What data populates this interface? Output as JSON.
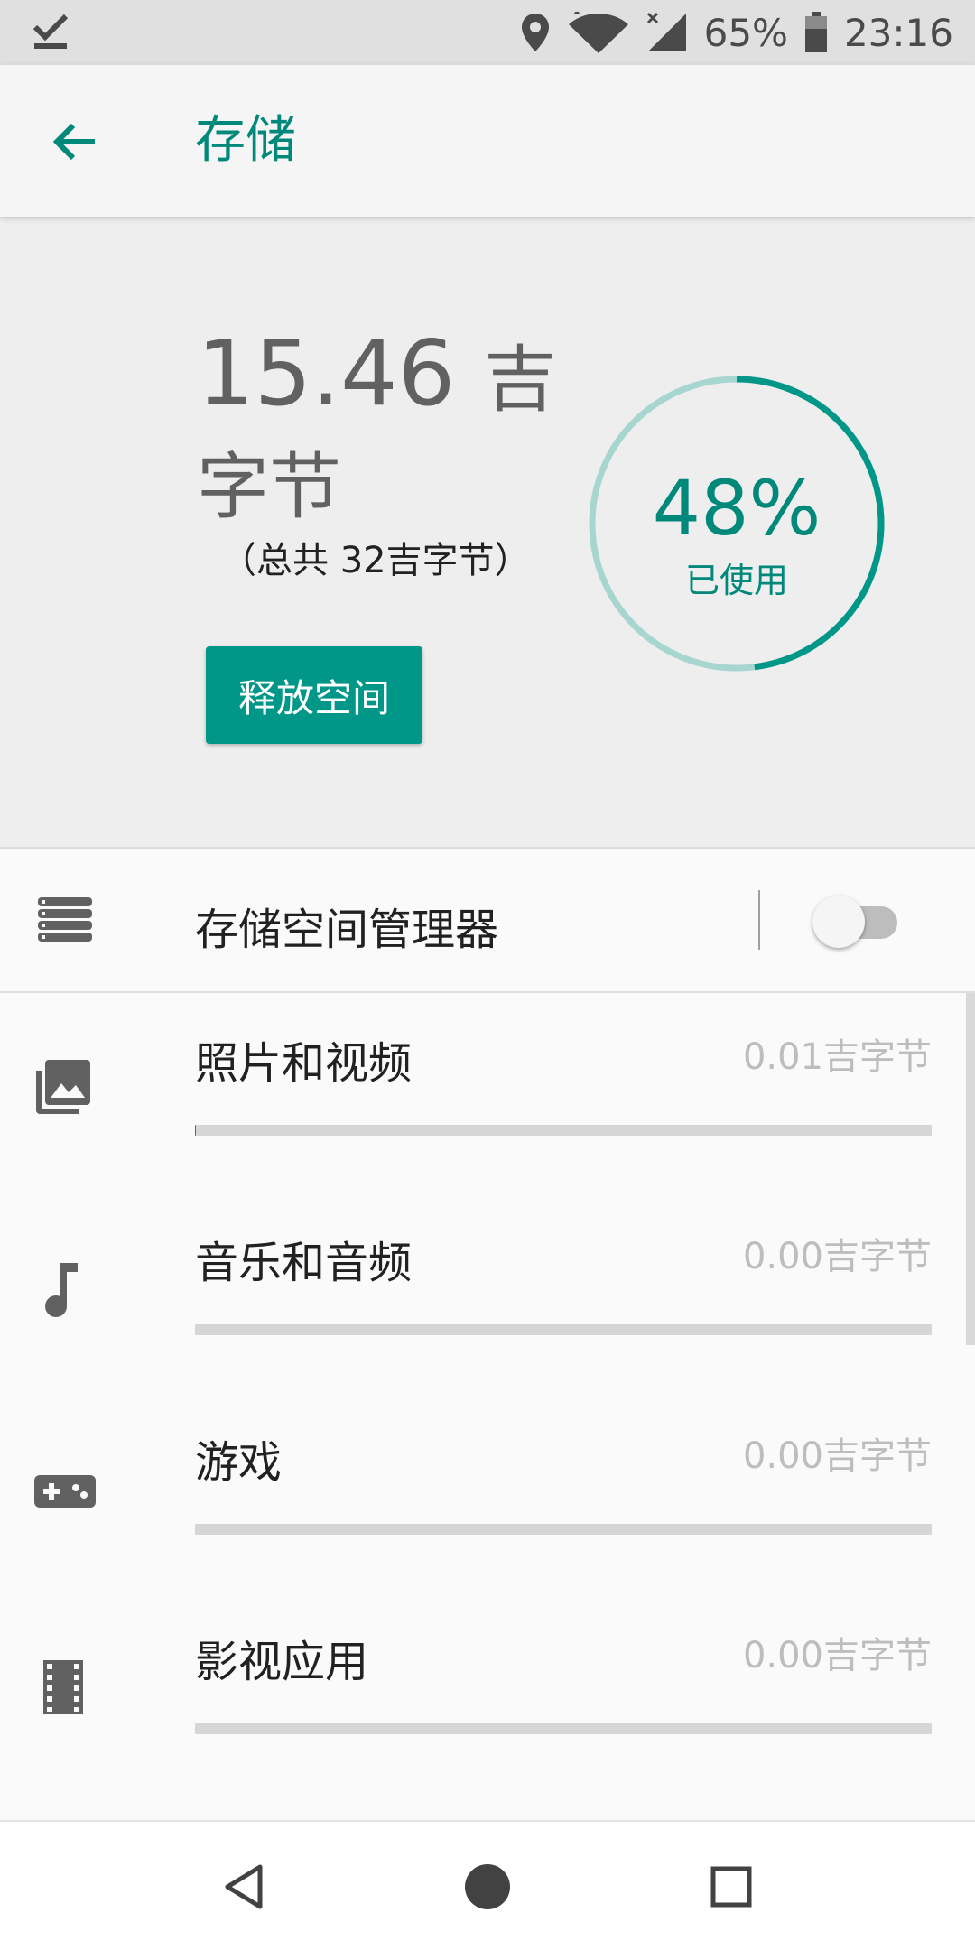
{
  "status_bar": {
    "left_icon": "download-done-icon",
    "icons": [
      "location-icon",
      "wifi-icon",
      "signal-icon",
      "battery-icon"
    ],
    "battery_percent": "65%",
    "time": "23:16"
  },
  "app_bar": {
    "back_icon": "arrow-back-icon",
    "title": "存储"
  },
  "summary": {
    "used_value": "15.46",
    "used_unit": "吉字节",
    "total_text": "（总共 32吉字节）",
    "free_button_label": "释放空间",
    "percent_used": 48,
    "percent_text": "48%",
    "percent_label": "已使用"
  },
  "manager": {
    "icon": "storage-icon",
    "label": "存储空间管理器",
    "toggle_on": false
  },
  "categories": [
    {
      "icon": "photo-library-icon",
      "label": "照片和视频",
      "size": "0.01吉字节",
      "fraction": 0.0006
    },
    {
      "icon": "music-note-icon",
      "label": "音乐和音频",
      "size": "0.00吉字节",
      "fraction": 0
    },
    {
      "icon": "gamepad-icon",
      "label": "游戏",
      "size": "0.00吉字节",
      "fraction": 0
    },
    {
      "icon": "movie-icon",
      "label": "影视应用",
      "size": "0.00吉字节",
      "fraction": 0
    }
  ],
  "nav_bar": {
    "icons": [
      "nav-back-icon",
      "nav-home-icon",
      "nav-recents-icon"
    ]
  },
  "colors": {
    "accent": "#009688",
    "accent_text": "#00897b",
    "ring_track": "#a7d6d1"
  }
}
